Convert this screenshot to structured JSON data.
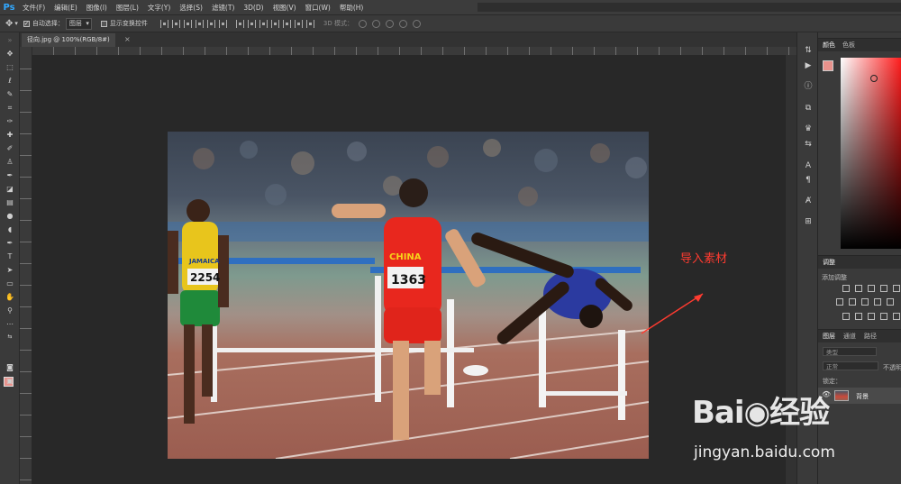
{
  "app": {
    "logo": "Ps"
  },
  "menu": [
    "文件(F)",
    "编辑(E)",
    "图像(I)",
    "图层(L)",
    "文字(Y)",
    "选择(S)",
    "滤镜(T)",
    "3D(D)",
    "视图(V)",
    "窗口(W)",
    "帮助(H)"
  ],
  "options": {
    "auto_select_label": "自动选择：",
    "auto_select_value": "图层",
    "show_transform_label": "显示变换控件",
    "mode_3d_label": "3D 模式："
  },
  "document": {
    "tab_label": "径向.jpg @ 100%(RGB/8#)",
    "close": "×"
  },
  "annotation": {
    "text": "导入素材",
    "color": "#ff3b30"
  },
  "photo": {
    "runners": [
      {
        "country": "JAMAICA",
        "bib": "2254"
      },
      {
        "country": "CHINA",
        "bib": "1363"
      }
    ]
  },
  "panels": {
    "color_tabs": [
      "颜色",
      "色板"
    ],
    "adjustments_title": "调整",
    "adjustments_subtitle": "添加调整",
    "layers_tabs": [
      "图层",
      "通道",
      "路径"
    ],
    "kind_placeholder": "类型",
    "blend_mode": "正常",
    "opacity_label": "不透明",
    "lock_label": "锁定：",
    "layer_name": "背景"
  },
  "colors": {
    "foreground": "#e8928c",
    "background": "#ffffff",
    "accent": "#31a8ff"
  },
  "watermark": {
    "logo": "Bai◉经验",
    "url": "jingyan.baidu.com"
  }
}
